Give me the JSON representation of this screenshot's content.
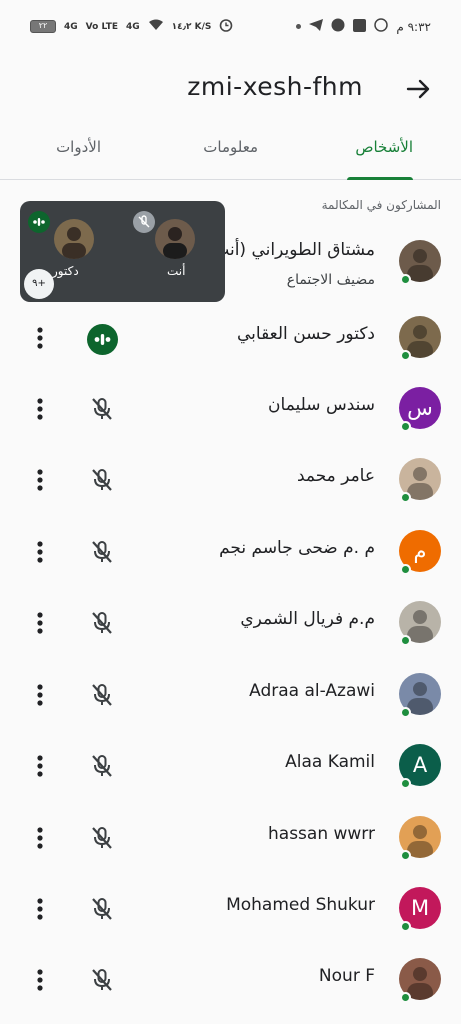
{
  "status_bar": {
    "time": "٩:٣٢ م",
    "battery": "٢٢",
    "net1": "4G",
    "net2": "Vo LTE",
    "net3": "4G",
    "speed": "١٤٫٢ K/S"
  },
  "header": {
    "title": "zmi-xesh-fhm"
  },
  "tabs": [
    {
      "label": "الأشخاص"
    },
    {
      "label": "معلومات"
    },
    {
      "label": "الأدوات"
    }
  ],
  "section_label": "المشاركون في المكالمة",
  "overlay": {
    "self_label": "أنت",
    "other_label": "دكتور",
    "more_count": "٩+"
  },
  "participants": [
    {
      "name": "مشتاق الطويراني (أنت)",
      "sub": "مضيف الاجتماع",
      "avatar": "photo",
      "color": "#6d5b4b"
    },
    {
      "name": "دكتور حسن العقابي",
      "avatar": "photo",
      "color": "#7d6a4d",
      "speaking": true
    },
    {
      "name": "سندس سليمان",
      "avatar": "letter",
      "letter": "س",
      "color": "#7b1fa2"
    },
    {
      "name": "عامر محمد",
      "avatar": "photo",
      "color": "#c9b49d"
    },
    {
      "name": "م .م ضحى جاسم نجم",
      "avatar": "letter",
      "letter": "م",
      "color": "#ef6c00"
    },
    {
      "name": "م.م فريال الشمري",
      "avatar": "photo",
      "color": "#b8b3a8"
    },
    {
      "name": "Adraa al-Azawi",
      "avatar": "photo",
      "color": "#7a8aa8"
    },
    {
      "name": "Alaa Kamil",
      "avatar": "letter",
      "letter": "A",
      "color": "#0b5e4a"
    },
    {
      "name": "hassan wwrr",
      "avatar": "photo",
      "color": "#e2a055"
    },
    {
      "name": "Mohamed Shukur",
      "avatar": "letter",
      "letter": "M",
      "color": "#c2185b"
    },
    {
      "name": "Nour F",
      "avatar": "photo",
      "color": "#8a5a48"
    }
  ]
}
